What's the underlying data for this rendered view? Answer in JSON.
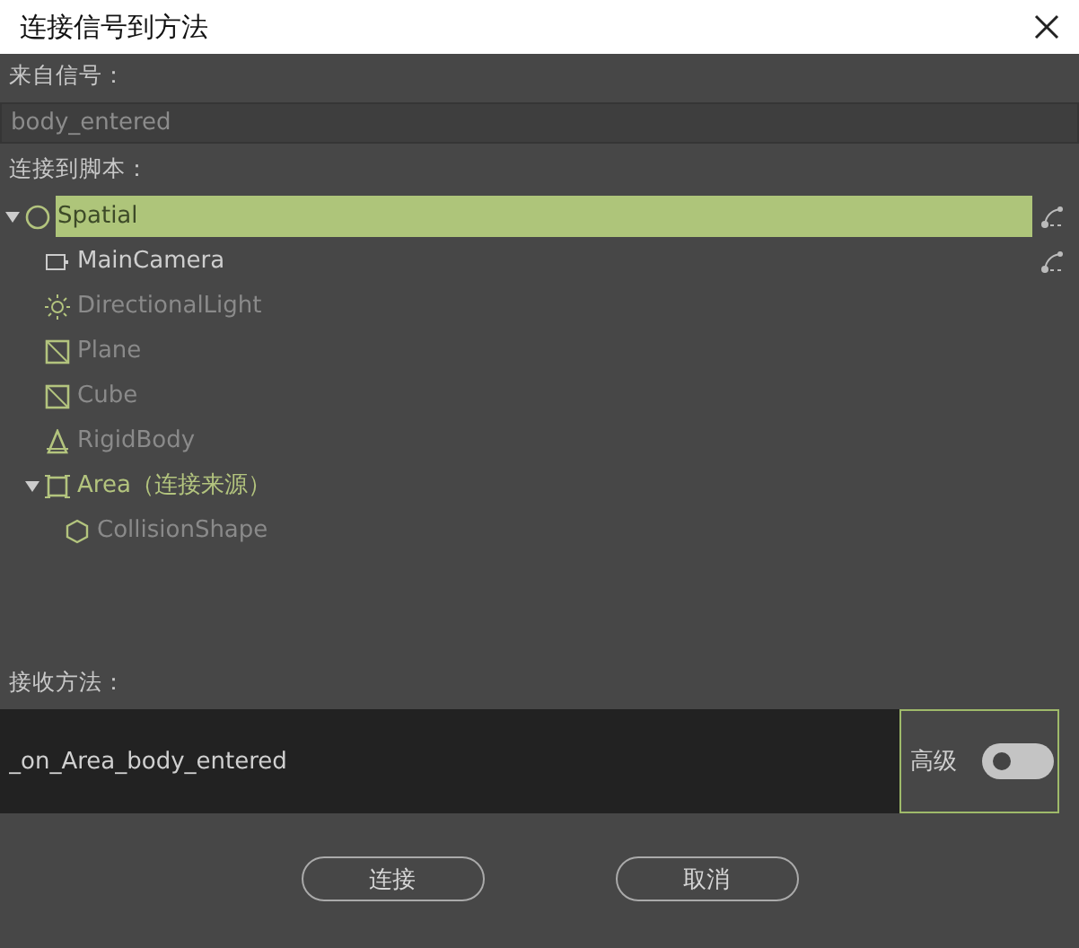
{
  "window": {
    "title": "连接信号到方法"
  },
  "signal": {
    "label": "来自信号：",
    "value": "body_entered"
  },
  "tree_label": "连接到脚本：",
  "tree": [
    {
      "label": "Spatial",
      "kind": "spatial",
      "selected": true,
      "disabled": false,
      "source": false,
      "has_script": true,
      "expanded": true,
      "children": [
        {
          "label": "MainCamera",
          "kind": "camera",
          "selected": false,
          "disabled": false,
          "source": false,
          "has_script": true
        },
        {
          "label": "DirectionalLight",
          "kind": "light",
          "selected": false,
          "disabled": true,
          "source": false,
          "has_script": false
        },
        {
          "label": "Plane",
          "kind": "mesh",
          "selected": false,
          "disabled": true,
          "source": false,
          "has_script": false
        },
        {
          "label": "Cube",
          "kind": "mesh",
          "selected": false,
          "disabled": true,
          "source": false,
          "has_script": false
        },
        {
          "label": "RigidBody",
          "kind": "body",
          "selected": false,
          "disabled": true,
          "source": false,
          "has_script": false
        },
        {
          "label": "Area（连接来源）",
          "kind": "area",
          "selected": false,
          "disabled": false,
          "source": true,
          "has_script": false,
          "expanded": true,
          "children": [
            {
              "label": "CollisionShape",
              "kind": "shape",
              "selected": false,
              "disabled": true,
              "source": false,
              "has_script": false
            }
          ]
        }
      ]
    }
  ],
  "method": {
    "label": "接收方法：",
    "value": "_on_Area_body_entered"
  },
  "advanced": {
    "label": "高级",
    "on": false
  },
  "buttons": [
    "连接",
    "取消"
  ]
}
